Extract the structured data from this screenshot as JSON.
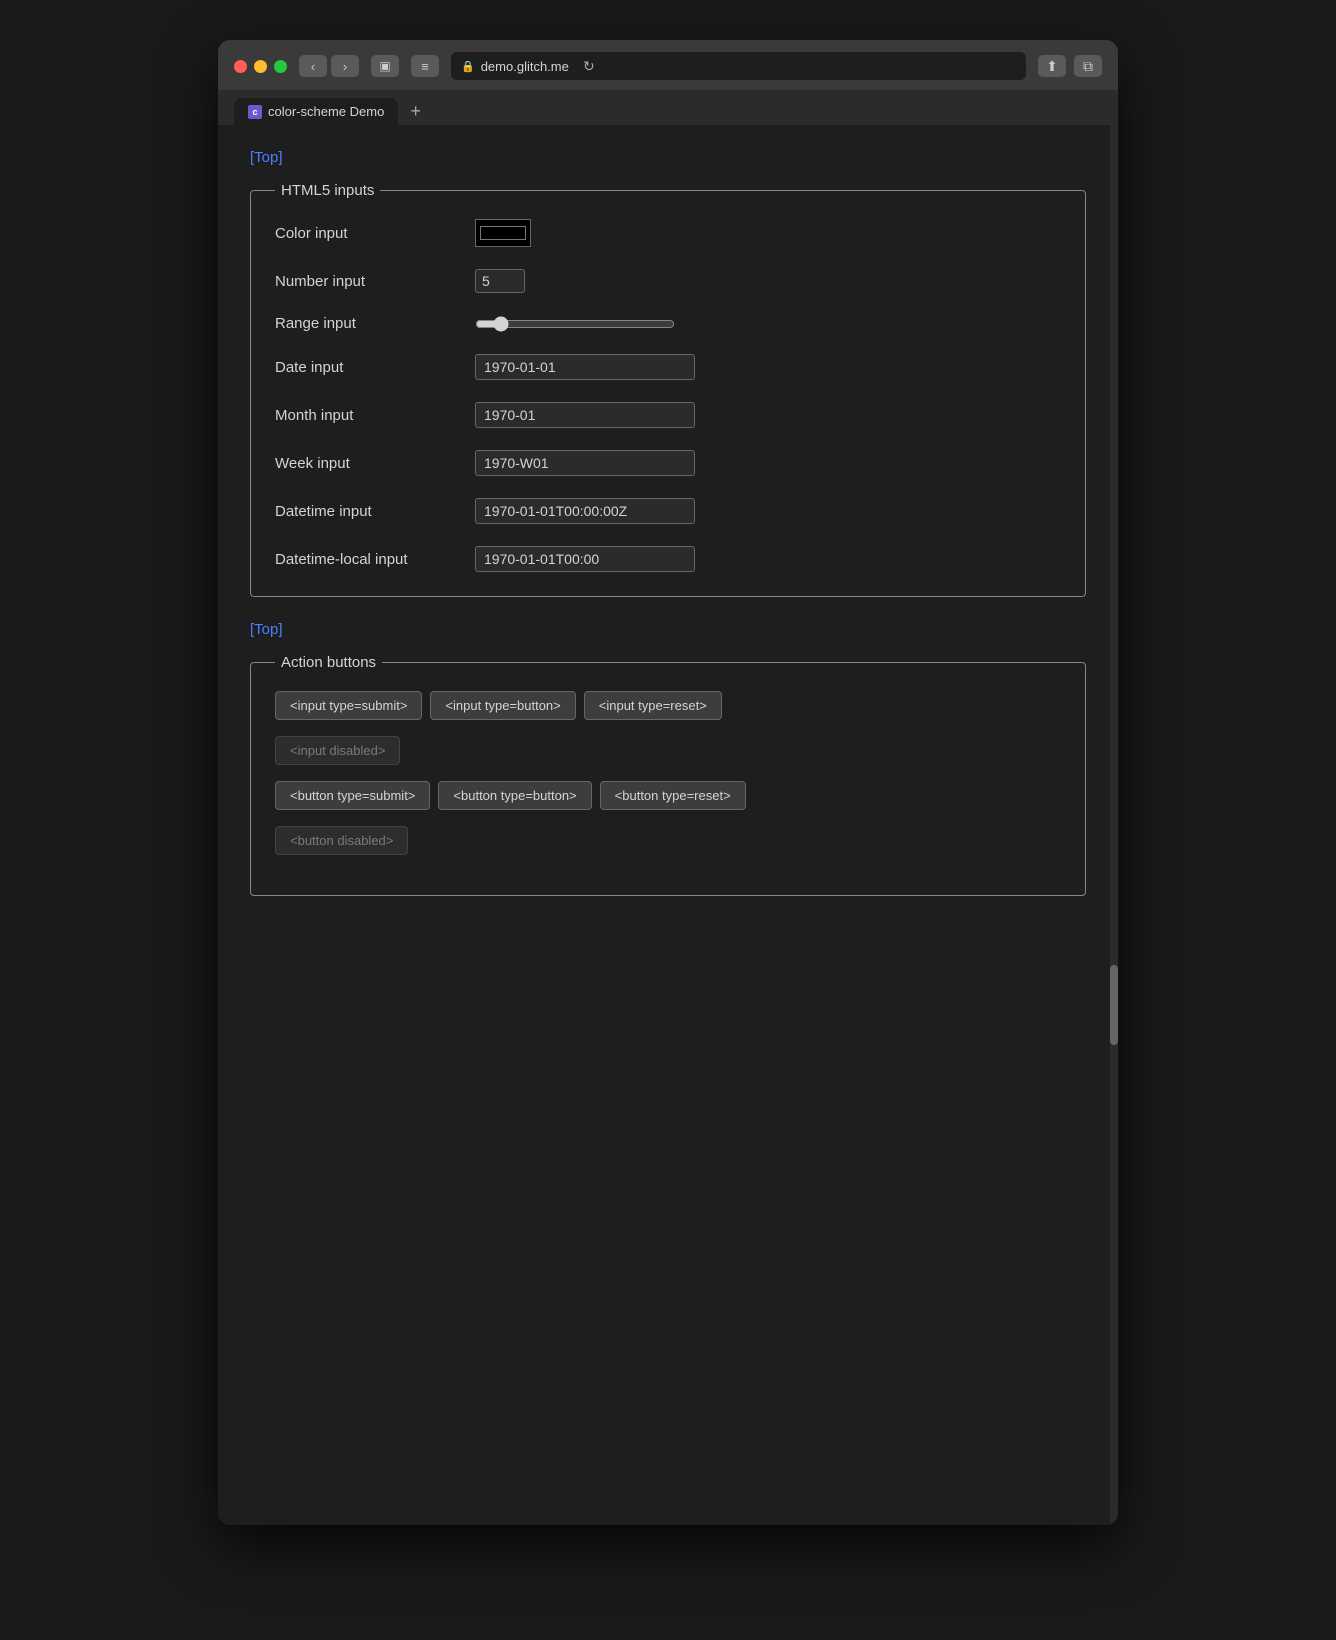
{
  "browser": {
    "url": "demo.glitch.me",
    "tab_title": "color-scheme Demo",
    "tab_favicon_letter": "c",
    "reload_icon": "↻",
    "back_icon": "‹",
    "forward_icon": "›",
    "share_icon": "⬆",
    "duplicate_icon": "⧉",
    "sidebar_icon": "▣",
    "menu_icon": "≡",
    "new_tab_icon": "+"
  },
  "top_link": "[Top]",
  "html5_section": {
    "legend": "HTML5 inputs",
    "color_label": "Color input",
    "color_value": "#000000",
    "number_label": "Number input",
    "number_value": "5",
    "range_label": "Range input",
    "range_value": "10",
    "date_label": "Date input",
    "date_value": "1970-01-01",
    "month_label": "Month input",
    "month_value": "1970-01",
    "week_label": "Week input",
    "week_value": "1970-W01",
    "datetime_label": "Datetime input",
    "datetime_value": "1970-01-01T00:00:00Z",
    "datetime_local_label": "Datetime-local input",
    "datetime_local_value": "1970-01-01T00:00"
  },
  "bottom_link": "[Top]",
  "action_section": {
    "legend": "Action buttons",
    "buttons_row1": [
      "<input type=submit>",
      "<input type=button>",
      "<input type=reset>"
    ],
    "disabled_input": "<input disabled>",
    "buttons_row2": [
      "<button type=submit>",
      "<button type=button>",
      "<button type=reset>"
    ],
    "disabled_button": "<button disabled>"
  }
}
